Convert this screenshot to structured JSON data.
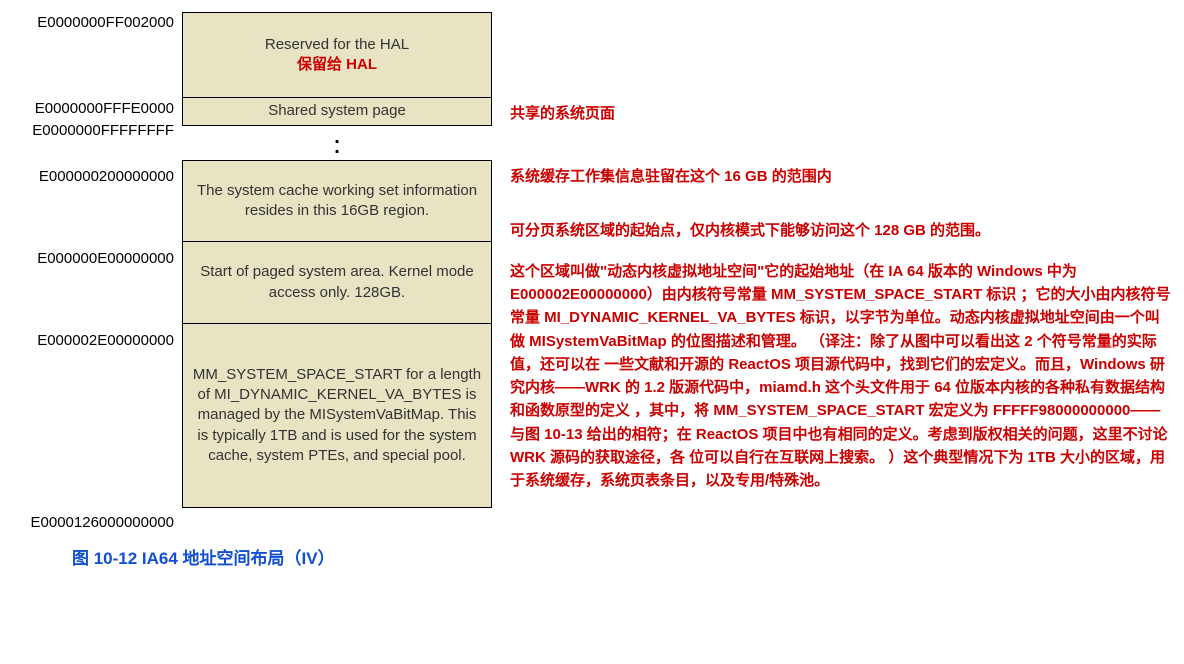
{
  "addresses": {
    "a1": "E0000000FF002000",
    "a2": "E0000000FFFE0000",
    "a3": "E0000000FFFFFFFF",
    "a4": "E000000200000000",
    "a5": "E000000E00000000",
    "a6": "E000002E00000000",
    "a7": "E0000126000000000"
  },
  "blocks": {
    "hal_en": "Reserved for the HAL",
    "hal_zh": "保留给 HAL",
    "shared": "Shared system page",
    "cache": "The system cache working set information resides in this 16GB region.",
    "paged": "Start of paged system area. Kernel mode access only. 128GB.",
    "mm": "MM_SYSTEM_SPACE_START for a length of MI_DYNAMIC_KERNEL_VA_BYTES is managed by the MISystemVaBitMap. This is typically 1TB and is used for the system cache, system PTEs, and special pool."
  },
  "annotations": {
    "shared": "共享的系统页面",
    "cache": "系统缓存工作集信息驻留在这个 16 GB 的范围内",
    "paged": "可分页系统区域的起始点，仅内核模式下能够访问这个 128 GB 的范围。",
    "mm": "这个区域叫做\"动态内核虚拟地址空间\"它的起始地址（在 IA 64 版本的 Windows 中为 E000002E00000000）由内核符号常量 MM_SYSTEM_SPACE_START 标识  ；它的大小由内核符号常量  MI_DYNAMIC_KERNEL_VA_BYTES 标识，以字节为单位。动态内核虚拟地址空间由一个叫做 MISystemVaBitMap 的位图描述和管理。 （译注：除了从图中可以看出这 2 个符号常量的实际值，还可以在 一些文献和开源的 ReactOS 项目源代码中，找到它们的宏定义。而且，Windows 研究内核——WRK 的 1.2  版源代码中，miamd.h 这个头文件用于 64 位版本内核的各种私有数据结构和函数原型的定义  ，其中，将 MM_SYSTEM_SPACE_START 宏定义为 FFFFF98000000000——与图 10-13 给出的相符；在 ReactOS 项目中也有相同的定义。考虑到版权相关的问题，这里不讨论 WRK 源码的获取途径，各 位可以自行在互联网上搜索。 ）这个典型情况下为 1TB 大小的区域，用于系统缓存，系统页表条目，以及专用/特殊池。"
  },
  "caption": "图 10-12  IA64 地址空间布局（IV）",
  "dots": "⁞"
}
